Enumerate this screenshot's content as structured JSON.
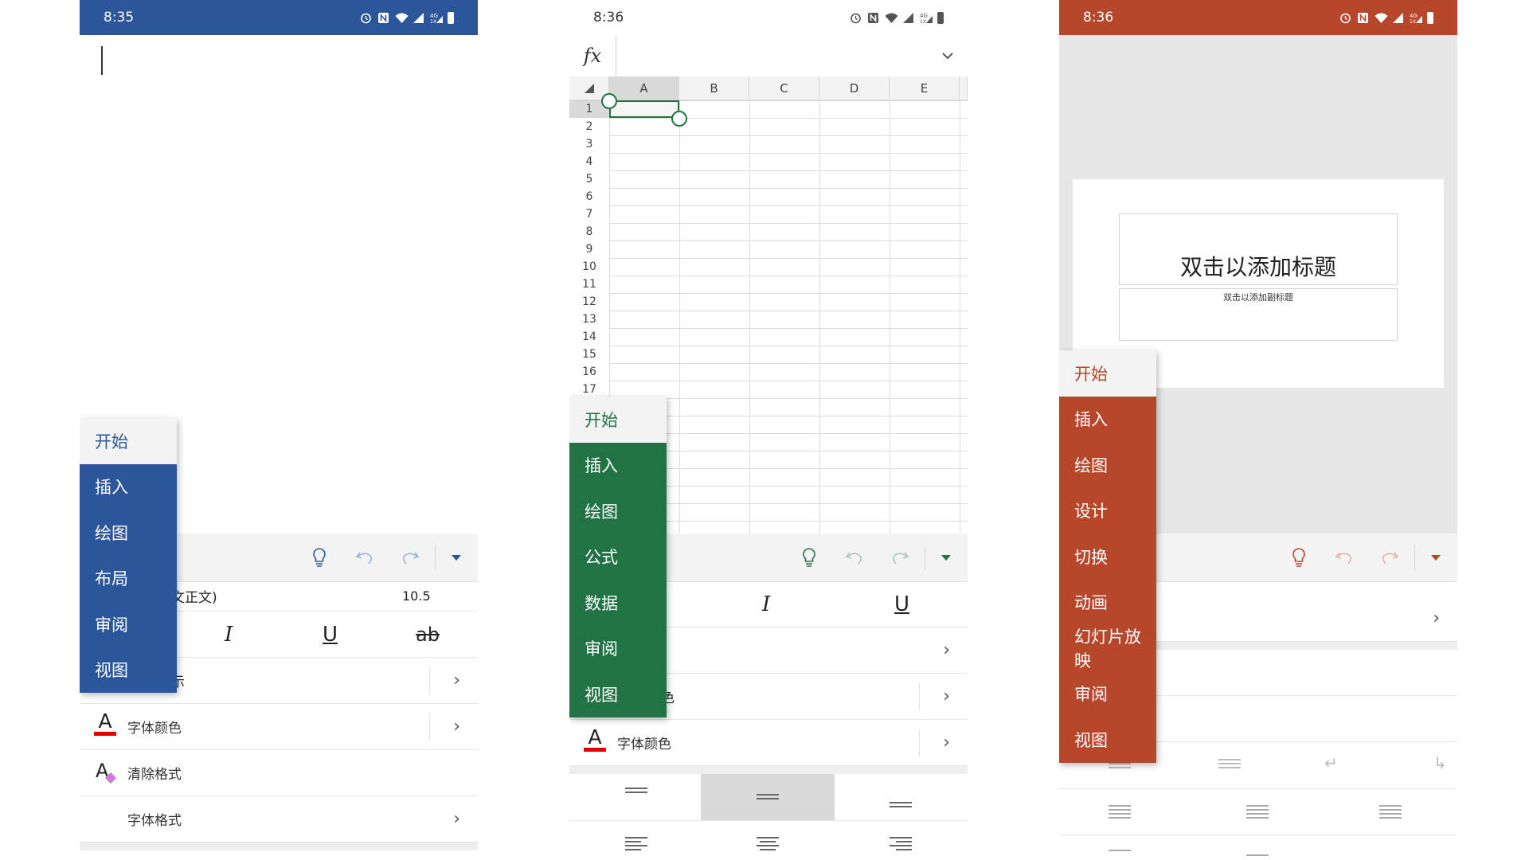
{
  "word": {
    "status": {
      "time": "8:35"
    },
    "toolbar": {
      "lightbulb": "lightbulb-icon",
      "undo": "undo-icon",
      "redo": "redo-icon",
      "more": "caret-down-icon"
    },
    "font_name_partial": "文正文)",
    "font_size": "10.5",
    "format": {
      "italic": "I",
      "underline": "U",
      "strike": "ab"
    },
    "row_partial": "示",
    "font_color_icon": "A",
    "font_color_label": "字体颜色",
    "clear_format_icon": "A",
    "clear_format_label": "清除格式",
    "font_format_label": "字体格式",
    "menu": [
      "开始",
      "插入",
      "绘图",
      "布局",
      "审阅",
      "视图"
    ],
    "colors": {
      "accent": "#2b579a"
    }
  },
  "excel": {
    "status": {
      "time": "8:36"
    },
    "fx_label": "fx",
    "columns": [
      "A",
      "B",
      "C",
      "D",
      "E"
    ],
    "rows": [
      "1",
      "2",
      "3",
      "4",
      "5",
      "6",
      "7",
      "8",
      "9",
      "10",
      "11",
      "12",
      "13",
      "14",
      "15",
      "16",
      "17"
    ],
    "format": {
      "italic": "I",
      "underline": "U"
    },
    "row_partial": "色",
    "font_color_icon": "A",
    "font_color_label": "字体颜色",
    "menu": [
      "开始",
      "插入",
      "绘图",
      "公式",
      "数据",
      "审阅",
      "视图"
    ],
    "colors": {
      "accent": "#217346"
    }
  },
  "ppt": {
    "status": {
      "time": "8:36"
    },
    "slide_title": "双击以添加标题",
    "slide_subtitle": "双击以添加副标题",
    "menu": [
      "开始",
      "插入",
      "绘图",
      "设计",
      "切换",
      "动画",
      "幻灯片放映",
      "审阅",
      "视图"
    ],
    "colors": {
      "accent": "#b7472a"
    }
  }
}
